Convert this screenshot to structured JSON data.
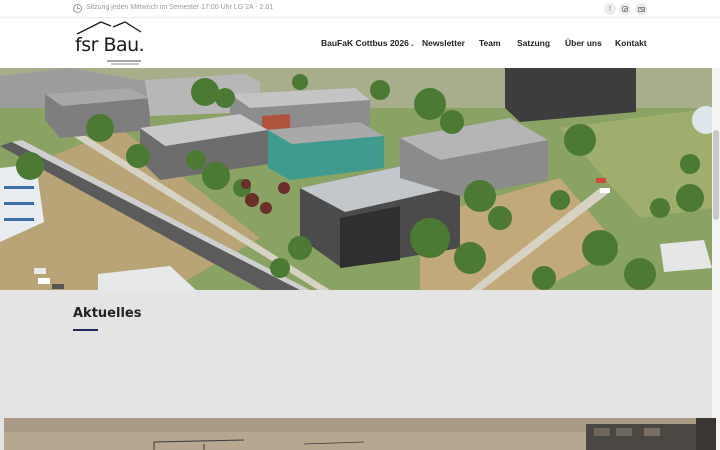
{
  "topbar": {
    "info_text": "Sitzung jeden Mittwoch im Semester 17:00 Uhr LG 2A - 2.01",
    "social_icons": [
      "facebook-icon",
      "instagram-icon",
      "mail-icon"
    ]
  },
  "header": {
    "logo_text": "fsr Bau.",
    "nav": [
      {
        "label": "BauFaK Cottbus 2026",
        "has_submenu": true
      },
      {
        "label": "Newsletter"
      },
      {
        "label": "Team"
      },
      {
        "label": "Satzung"
      },
      {
        "label": "Über uns"
      },
      {
        "label": "Kontakt"
      }
    ]
  },
  "main": {
    "section_title": "Aktuelles"
  },
  "colors": {
    "accent": "#1e2a5e",
    "background": "#e4e4e4",
    "header": "#ffffff"
  }
}
